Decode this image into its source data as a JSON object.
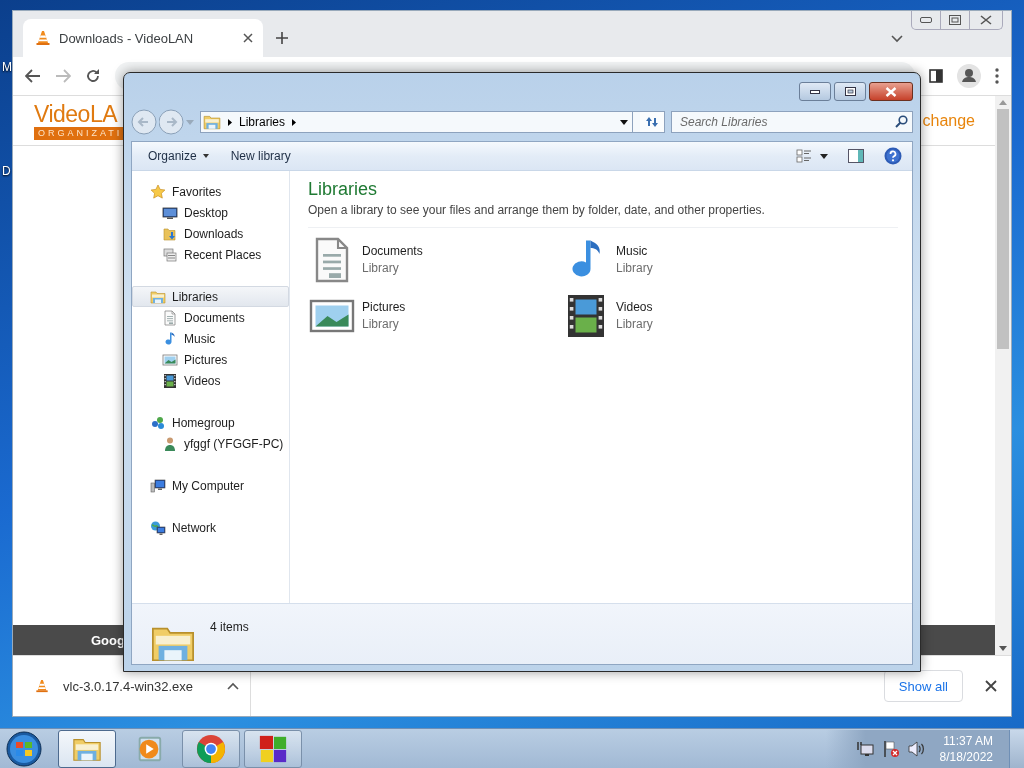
{
  "desktop": {
    "icon_labels": [
      "M",
      "D"
    ]
  },
  "browser": {
    "tabs": [
      {
        "title": "Downloads - VideoLAN",
        "selected": true
      }
    ],
    "page": {
      "logo": "VideoLA",
      "logo_tagline": "ORGANIZATI",
      "header_link": "change",
      "footer_text": "Goog"
    },
    "downloads": [
      {
        "file": "vlc-3.0.17.4-win32.exe"
      }
    ],
    "show_all": "Show all"
  },
  "explorer": {
    "breadcrumb": [
      "Libraries"
    ],
    "search_placeholder": "Search Libraries",
    "commands": [
      {
        "label": "Organize",
        "menu": true
      },
      {
        "label": "New library",
        "menu": false
      }
    ],
    "nav": [
      {
        "label": "Favorites",
        "kind": "star",
        "selected": false,
        "children": [
          {
            "label": "Desktop",
            "kind": "desktop",
            "selected": false
          },
          {
            "label": "Downloads",
            "kind": "downloads",
            "selected": false
          },
          {
            "label": "Recent Places",
            "kind": "recent",
            "selected": false
          }
        ]
      },
      {
        "label": "Libraries",
        "kind": "library",
        "selected": true,
        "children": [
          {
            "label": "Documents",
            "kind": "document",
            "selected": false
          },
          {
            "label": "Music",
            "kind": "music",
            "selected": false
          },
          {
            "label": "Pictures",
            "kind": "pictures",
            "selected": false
          },
          {
            "label": "Videos",
            "kind": "videos",
            "selected": false
          }
        ]
      },
      {
        "label": "Homegroup",
        "kind": "homegroup",
        "selected": false,
        "children": [
          {
            "label": "yfggf (YFGGF-PC)",
            "kind": "user",
            "selected": false
          }
        ]
      },
      {
        "label": "My Computer",
        "kind": "computer",
        "selected": false
      },
      {
        "label": "Network",
        "kind": "network",
        "selected": false
      }
    ],
    "heading": "Libraries",
    "description": "Open a library to see your files and arrange them by folder, date, and other properties.",
    "items": [
      {
        "name": "Documents",
        "type": "Library",
        "kind": "document"
      },
      {
        "name": "Music",
        "type": "Library",
        "kind": "music"
      },
      {
        "name": "Pictures",
        "type": "Library",
        "kind": "pictures"
      },
      {
        "name": "Videos",
        "type": "Library",
        "kind": "videos"
      }
    ],
    "status": "4 items"
  },
  "taskbar": {
    "apps": [
      {
        "kind": "explorer",
        "selected": true,
        "running": true
      },
      {
        "kind": "media",
        "selected": false,
        "running": false
      },
      {
        "kind": "chrome",
        "selected": false,
        "running": true
      },
      {
        "kind": "tiles",
        "selected": false,
        "running": true
      }
    ],
    "time": "11:37 AM",
    "date": "8/18/2022"
  }
}
